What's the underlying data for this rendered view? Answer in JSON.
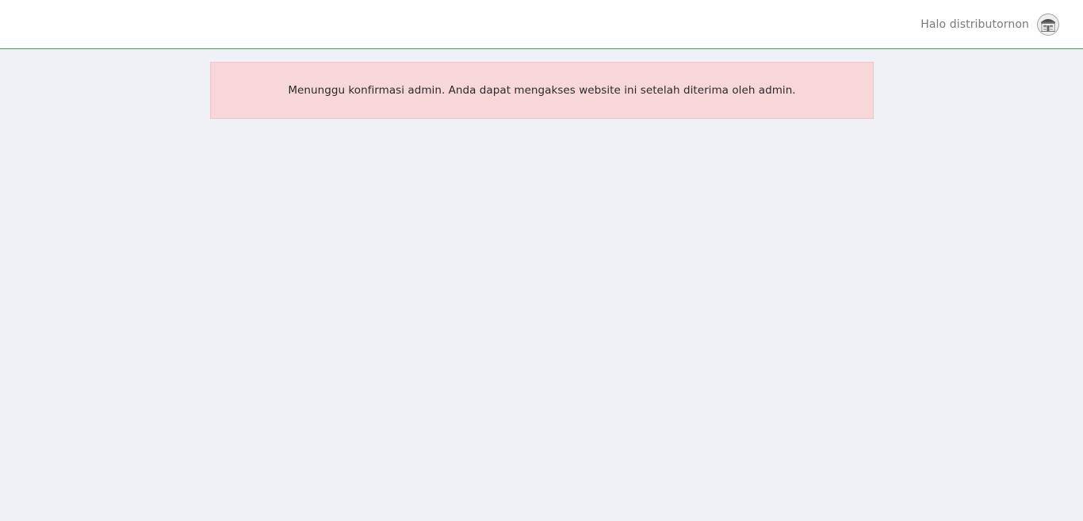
{
  "header": {
    "greeting": "Halo distributornon",
    "avatar_icon": "storefront-icon",
    "border_color": "#3fa34d"
  },
  "alert": {
    "message": "Menunggu konfirmasi admin. Anda dapat mengakses website ini setelah diterima oleh admin.",
    "background_color": "#f7d7da"
  }
}
